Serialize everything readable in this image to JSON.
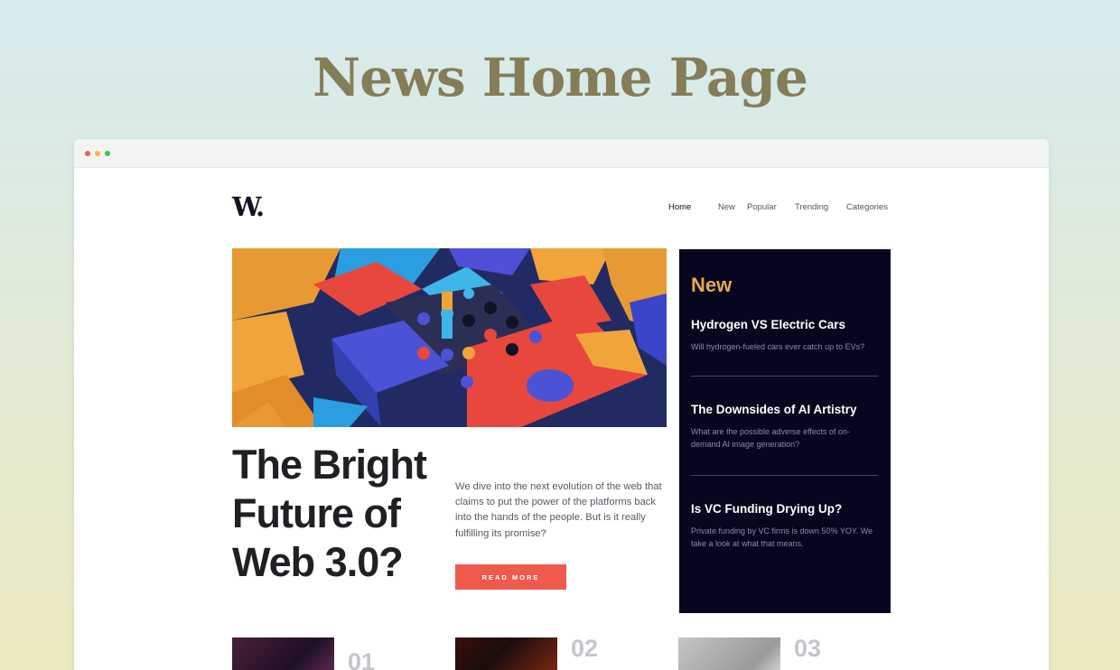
{
  "showcase_title": "News Home Page",
  "site": {
    "logo": "W."
  },
  "nav": {
    "items": [
      "Home",
      "New",
      "Popular",
      "Trending",
      "Categories"
    ],
    "active": "Home"
  },
  "hero": {
    "image": "abstract-3d-blocks-illustration",
    "title": "The Bright Future of Web 3.0?",
    "description": "We dive into the next evolution of the web that claims to put the power of the platforms back into the hands of the people. But is it really fulfilling its promise?",
    "cta_label": "READ MORE"
  },
  "new_panel": {
    "heading": "New",
    "items": [
      {
        "title": "Hydrogen VS Electric Cars",
        "summary": "Will hydrogen-fueled cars ever catch up to EVs?"
      },
      {
        "title": "The Downsides of AI Artistry",
        "summary": "What are the possible adverse effects of on-demand AI image generation?"
      },
      {
        "title": "Is VC Funding Drying Up?",
        "summary": "Private funding by VC firms is down 50% YOY. We take a look at what that means."
      }
    ]
  },
  "bottom_cards": [
    {
      "number": "01"
    },
    {
      "number": "02"
    },
    {
      "number": "03"
    }
  ],
  "colors": {
    "accent": "#ef5a4c",
    "new_heading": "#e8a84c",
    "panel_bg": "#06061e",
    "title_color": "#857d57"
  }
}
